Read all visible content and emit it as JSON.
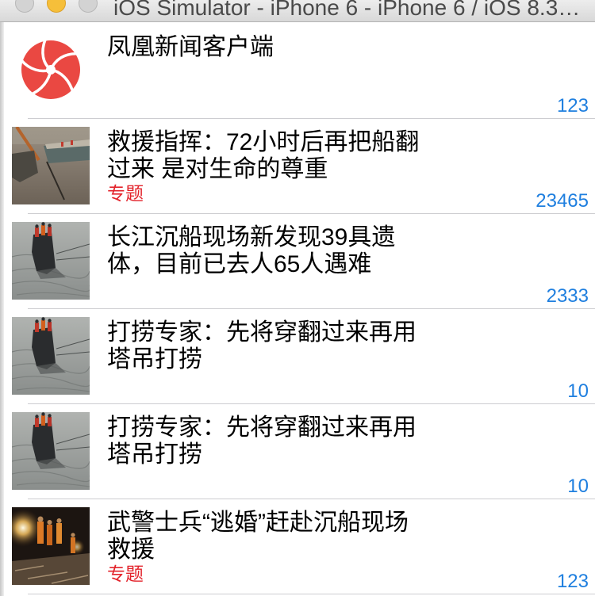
{
  "window": {
    "title": "iOS Simulator - iPhone 6 - iPhone 6 / iOS 8.3…"
  },
  "colors": {
    "count_blue": "#1f7fdf",
    "tag_red": "#e3232b",
    "separator": "#cdcdd1",
    "minimize_yellow": "#f6bf3a"
  },
  "news": [
    {
      "title_lines": [
        "凤凰新闻客户端"
      ],
      "count": 123
    },
    {
      "title_lines": [
        "救援指挥：72小时后再把船翻",
        "过来 是对生命的尊重"
      ],
      "tag": "专题",
      "count": 23465
    },
    {
      "title_lines": [
        "长江沉船现场新发现39具遗",
        "体，目前已去人65人遇难"
      ],
      "count": 2333
    },
    {
      "title_lines": [
        "打捞专家：先将穿翻过来再用",
        "塔吊打捞"
      ],
      "count": 10
    },
    {
      "title_lines": [
        "打捞专家：先将穿翻过来再用",
        "塔吊打捞"
      ],
      "count": 10
    },
    {
      "title_lines": [
        "武警士兵“逃婚”赶赴沉船现场",
        "救援"
      ],
      "tag": "专题",
      "count": 123
    }
  ]
}
